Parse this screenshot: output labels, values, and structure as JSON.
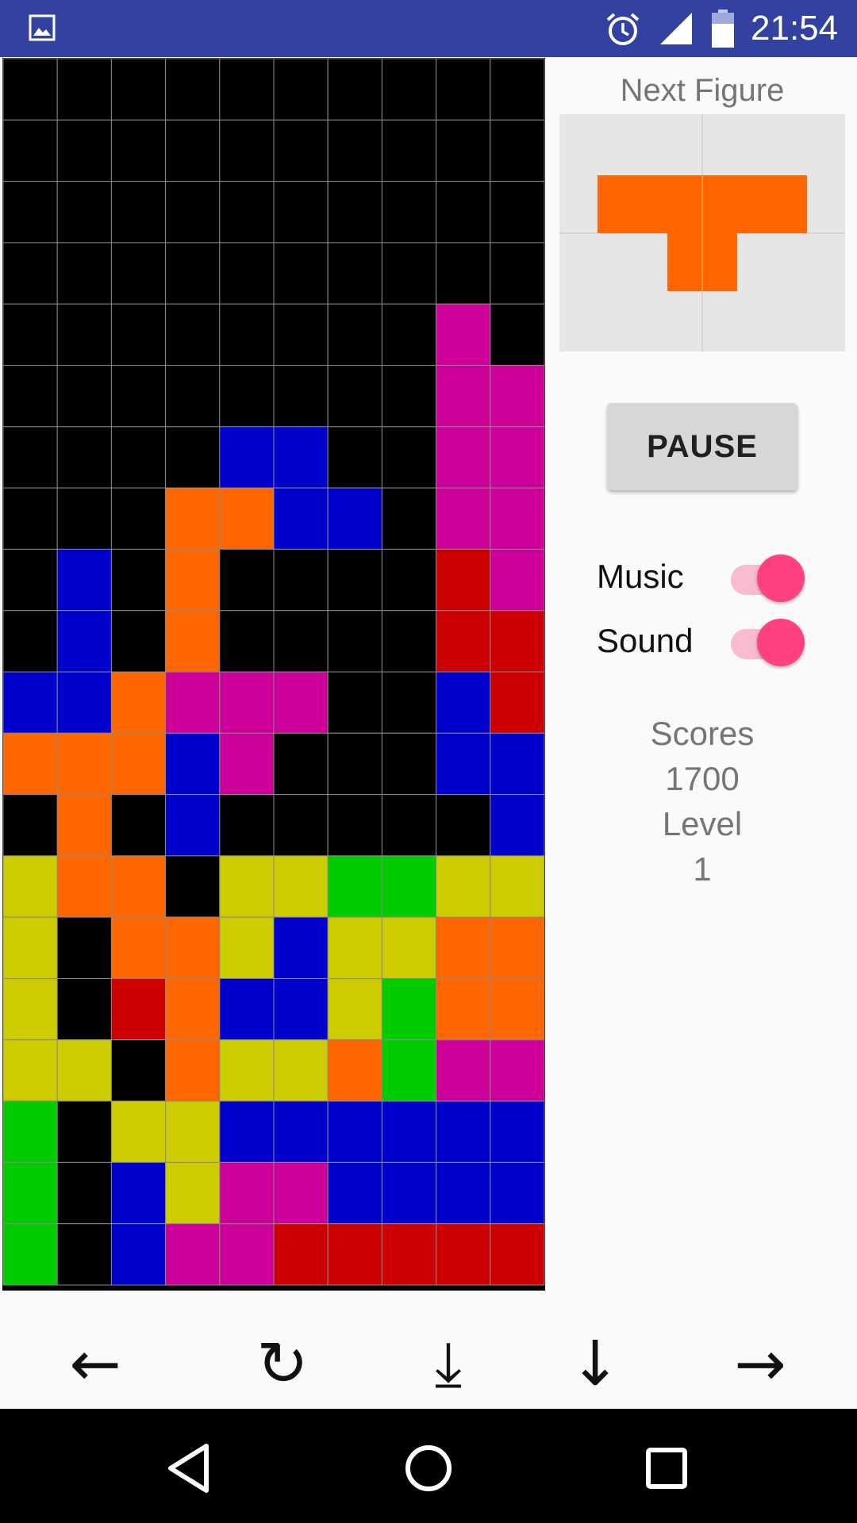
{
  "status_bar": {
    "time": "21:54",
    "icons": [
      "gallery-icon",
      "alarm-icon",
      "signal-icon",
      "battery-icon"
    ]
  },
  "board": {
    "cols": 10,
    "rows": 20,
    "legend": {
      ".": "#000000",
      "O": "#ff6600",
      "B": "#0000cc",
      "M": "#cc0099",
      "R": "#cc0000",
      "Y": "#cccc00",
      "G": "#00cc00"
    },
    "grid": [
      "..........",
      "..........",
      "..........",
      "..........",
      "........M.",
      "........MM",
      "....BB..MM",
      "...OOBB.MM",
      ".B.O....RM",
      ".B.O....RR",
      "BBOMMM..BR",
      "OOOBM...BB",
      ".O.B.....B",
      "YOO.YYGGYY",
      "Y.OOYBYYOO",
      "Y.ROBBYGOO",
      "YY.OYYOGMM",
      "G.YYBBBBBB",
      "G.BYMMBBBB",
      "G.BMMRRRRR"
    ]
  },
  "side_panel": {
    "next_label": "Next Figure",
    "next_piece": {
      "color": "#ff6600",
      "shape": "T"
    },
    "pause_label": "PAUSE",
    "music_label": "Music",
    "music_on": true,
    "sound_label": "Sound",
    "sound_on": true,
    "scores_label": "Scores",
    "scores_value": "1700",
    "level_label": "Level",
    "level_value": "1",
    "accent_color": "#ff4081"
  },
  "controls": {
    "left": "←",
    "rotate": "↻",
    "drop": "⤓",
    "down": "↓",
    "right": "→"
  },
  "nav_bar": {
    "icons": [
      "back-icon",
      "home-icon",
      "recents-icon"
    ]
  }
}
